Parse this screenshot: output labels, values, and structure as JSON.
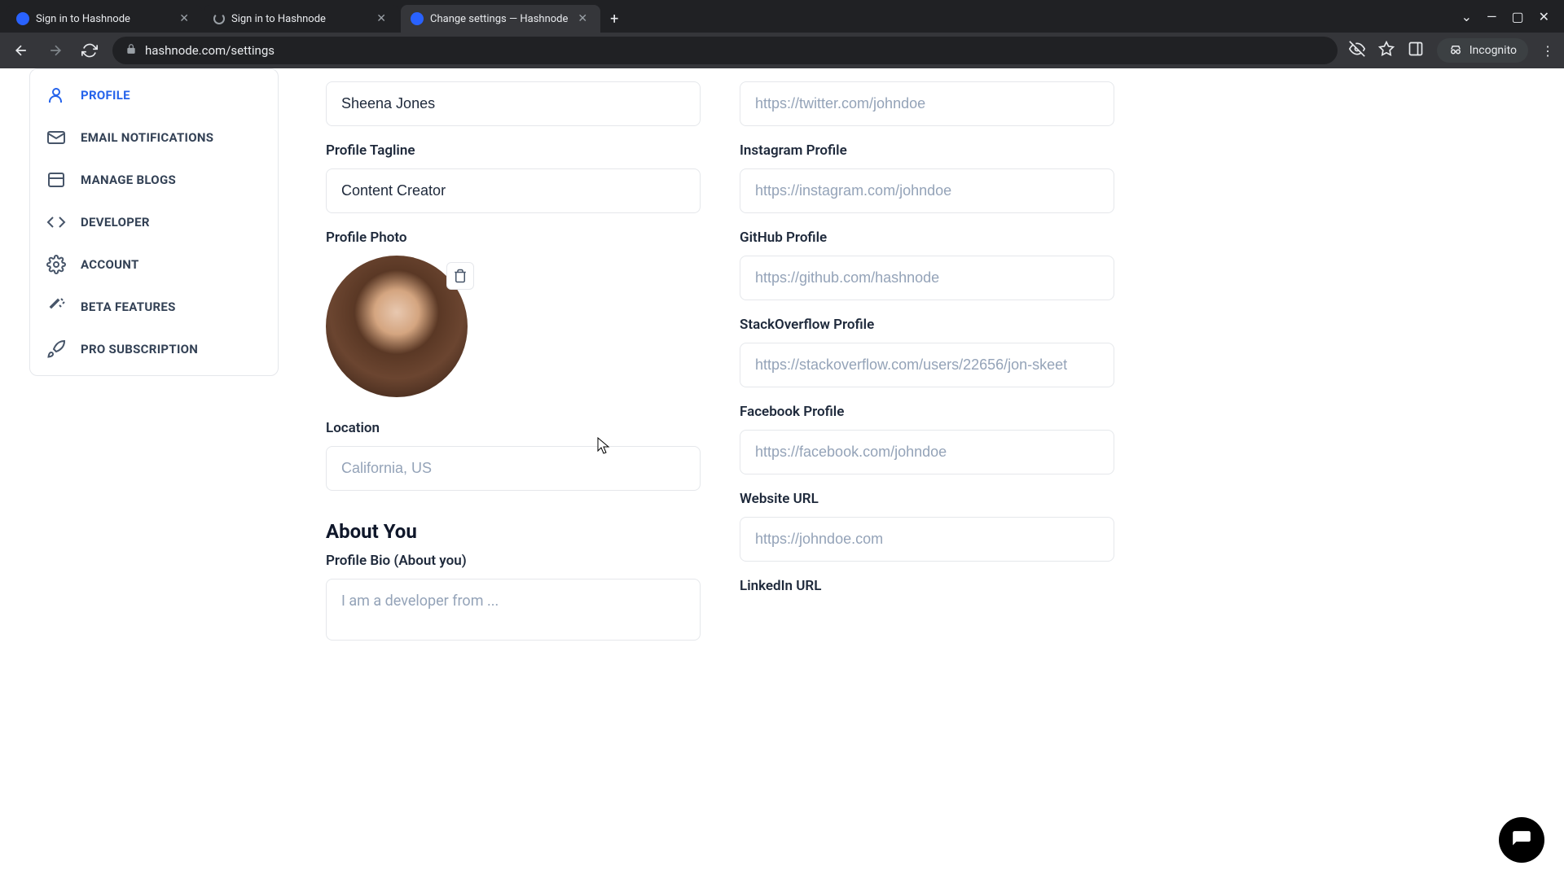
{
  "browser": {
    "tabs": [
      {
        "title": "Sign in to Hashnode",
        "active": false,
        "favicon": "hashnode"
      },
      {
        "title": "Sign in to Hashnode",
        "active": false,
        "favicon": "loading"
      },
      {
        "title": "Change settings — Hashnode",
        "active": true,
        "favicon": "hashnode"
      }
    ],
    "url": "hashnode.com/settings",
    "incognito_label": "Incognito"
  },
  "sidebar": {
    "items": [
      {
        "label": "PROFILE",
        "icon": "user",
        "active": true
      },
      {
        "label": "EMAIL NOTIFICATIONS",
        "icon": "mail",
        "active": false
      },
      {
        "label": "MANAGE BLOGS",
        "icon": "layout",
        "active": false
      },
      {
        "label": "DEVELOPER",
        "icon": "code",
        "active": false
      },
      {
        "label": "ACCOUNT",
        "icon": "gear",
        "active": false
      },
      {
        "label": "BETA FEATURES",
        "icon": "wand",
        "active": false
      },
      {
        "label": "PRO SUBSCRIPTION",
        "icon": "rocket",
        "active": false
      }
    ]
  },
  "form": {
    "basic": {
      "name": {
        "value": "Sheena Jones"
      },
      "tagline": {
        "label": "Profile Tagline",
        "value": "Content Creator"
      },
      "photo": {
        "label": "Profile Photo"
      },
      "location": {
        "label": "Location",
        "value": "",
        "placeholder": "California, US"
      }
    },
    "about": {
      "heading": "About You",
      "bio": {
        "label": "Profile Bio (About you)",
        "value": "",
        "placeholder": "I am a developer from ..."
      }
    },
    "social": {
      "twitter": {
        "value": "",
        "placeholder": "https://twitter.com/johndoe"
      },
      "instagram": {
        "label": "Instagram Profile",
        "value": "",
        "placeholder": "https://instagram.com/johndoe"
      },
      "github": {
        "label": "GitHub Profile",
        "value": "",
        "placeholder": "https://github.com/hashnode"
      },
      "stackoverflow": {
        "label": "StackOverflow Profile",
        "value": "",
        "placeholder": "https://stackoverflow.com/users/22656/jon-skeet"
      },
      "facebook": {
        "label": "Facebook Profile",
        "value": "",
        "placeholder": "https://facebook.com/johndoe"
      },
      "website": {
        "label": "Website URL",
        "value": "",
        "placeholder": "https://johndoe.com"
      },
      "linkedin": {
        "label": "LinkedIn URL"
      }
    }
  }
}
